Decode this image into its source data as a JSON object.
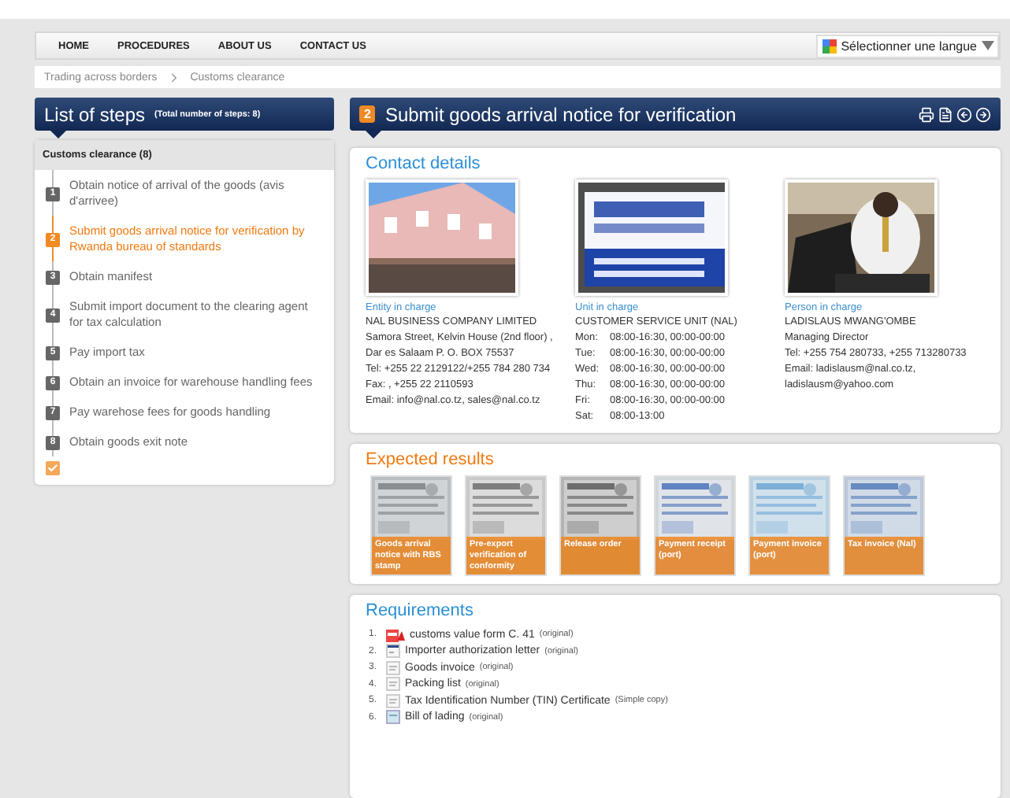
{
  "nav": {
    "items": [
      "HOME",
      "PROCEDURES",
      "ABOUT US",
      "CONTACT US"
    ],
    "language": "Sélectionner une langue"
  },
  "breadcrumb": [
    "Trading across borders",
    "Customs clearance"
  ],
  "steps_panel": {
    "title": "List of steps",
    "total": "(Total number of steps: 8)",
    "group": "Customs clearance (8)",
    "steps": [
      {
        "number": "1",
        "label": "Obtain notice of arrival of the goods (avis d'arrivee)",
        "selected": false
      },
      {
        "number": "2",
        "label": "Submit goods arrival notice for verification by Rwanda bureau of standards",
        "selected": true
      },
      {
        "number": "3",
        "label": "Obtain manifest",
        "selected": false
      },
      {
        "number": "4",
        "label": "Submit import document to the clearing agent for tax calculation",
        "selected": false
      },
      {
        "number": "5",
        "label": "Pay import tax",
        "selected": false
      },
      {
        "number": "6",
        "label": "Obtain an invoice for warehouse handling fees",
        "selected": false
      },
      {
        "number": "7",
        "label": "Pay warehose fees for goods handling",
        "selected": false
      },
      {
        "number": "8",
        "label": "Obtain goods exit note",
        "selected": false
      }
    ]
  },
  "step_header": {
    "number": "2",
    "title": "Submit goods arrival notice for verification"
  },
  "contact": {
    "title": "Contact details",
    "columns": [
      {
        "kind": "lines",
        "label": "Entity in charge",
        "lines": [
          "NAL BUSINESS COMPANY LIMITED",
          "Samora Street, Kelvin House (2nd floor) , Dar es Salaam P. O. BOX 75537",
          "Tel: +255 22 2129122/+255 784 280 734",
          "Fax: , +255 22 2110593",
          "Email: info@nal.co.tz, sales@nal.co.tz"
        ]
      },
      {
        "kind": "hours",
        "label": "Unit in charge",
        "name": "CUSTOMER SERVICE UNIT (NAL)",
        "hours": [
          {
            "day": "Mon:",
            "time": "08:00-16:30, 00:00-00:00"
          },
          {
            "day": "Tue:",
            "time": "08:00-16:30, 00:00-00:00"
          },
          {
            "day": "Wed:",
            "time": "08:00-16:30, 00:00-00:00"
          },
          {
            "day": "Thu:",
            "time": "08:00-16:30, 00:00-00:00"
          },
          {
            "day": "Fri:",
            "time": "08:00-16:30, 00:00-00:00"
          },
          {
            "day": "Sat:",
            "time": "08:00-13:00"
          }
        ]
      },
      {
        "kind": "lines",
        "label": "Person in charge",
        "lines": [
          "LADISLAUS MWANG'OMBE",
          "Managing Director",
          "Tel: +255 754 280733, +255 713280733",
          "Email: ladislausm@nal.co.tz, ladislausm@yahoo.com"
        ]
      }
    ]
  },
  "results": {
    "title": "Expected results",
    "items": [
      "Goods arrival notice with RBS stamp",
      "Pre-export verification of conformity",
      "Release order",
      "Payment receipt (port)",
      "Payment invoice (port)",
      "Tax invoice (Nal)"
    ]
  },
  "requirements": {
    "title": "Requirements",
    "items": [
      {
        "number": "1.",
        "kind": "pdf",
        "name": "customs value form C. 41",
        "note": "(original)"
      },
      {
        "number": "2.",
        "kind": "letter",
        "name": "Importer authorization letter",
        "note": "(original)"
      },
      {
        "number": "3.",
        "kind": "document",
        "name": "Goods invoice",
        "note": "(original)"
      },
      {
        "number": "4.",
        "kind": "document",
        "name": "Packing list",
        "note": "(original)"
      },
      {
        "number": "5.",
        "kind": "document",
        "name": "Tax Identification Number (TIN) Certificate",
        "note": "(Simple copy)"
      },
      {
        "number": "6.",
        "kind": "scan",
        "name": "Bill of lading",
        "note": "(original)"
      }
    ]
  }
}
